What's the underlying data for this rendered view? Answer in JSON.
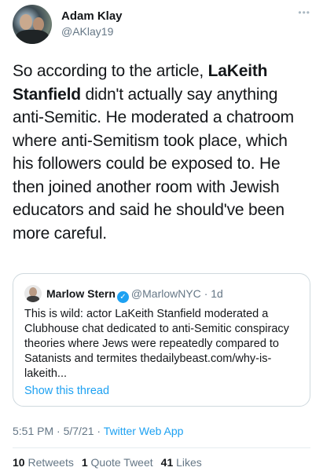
{
  "author": {
    "display_name": "Adam Klay",
    "handle": "@AKlay19"
  },
  "more_icon": "ellipsis-icon",
  "tweet": {
    "text_1": "So according to the article, ",
    "bold_1": "LaKeith Stanfield",
    "text_2": " didn't actually say anything anti-Semitic. He moderated a chatroom where anti-Semitism took place, which his followers could be exposed to. He then joined another room with Jewish educators and said he should've been more careful."
  },
  "quote": {
    "name": "Marlow Stern",
    "verified_icon": "verified-badge-icon",
    "handle": "@MarlowNYC",
    "separator": "·",
    "time": "1d",
    "text": "This is wild: actor LaKeith Stanfield moderated a Clubhouse chat dedicated to anti-Semitic conspiracy theories where Jews were repeatedly compared to Satanists and termites thedailybeast.com/why-is-lakeith...",
    "show_thread": "Show this thread"
  },
  "meta": {
    "time": "5:51 PM",
    "separator_1": "·",
    "date": "5/7/21",
    "separator_2": "·",
    "source": "Twitter Web App"
  },
  "stats": {
    "retweets_count": "10",
    "retweets_label": "Retweets",
    "quotes_count": "1",
    "quotes_label": "Quote Tweet",
    "likes_count": "41",
    "likes_label": "Likes"
  },
  "colors": {
    "link": "#1da1f2",
    "secondary_text": "#657786",
    "primary_text": "#14171a",
    "border": "#cfd9de"
  }
}
